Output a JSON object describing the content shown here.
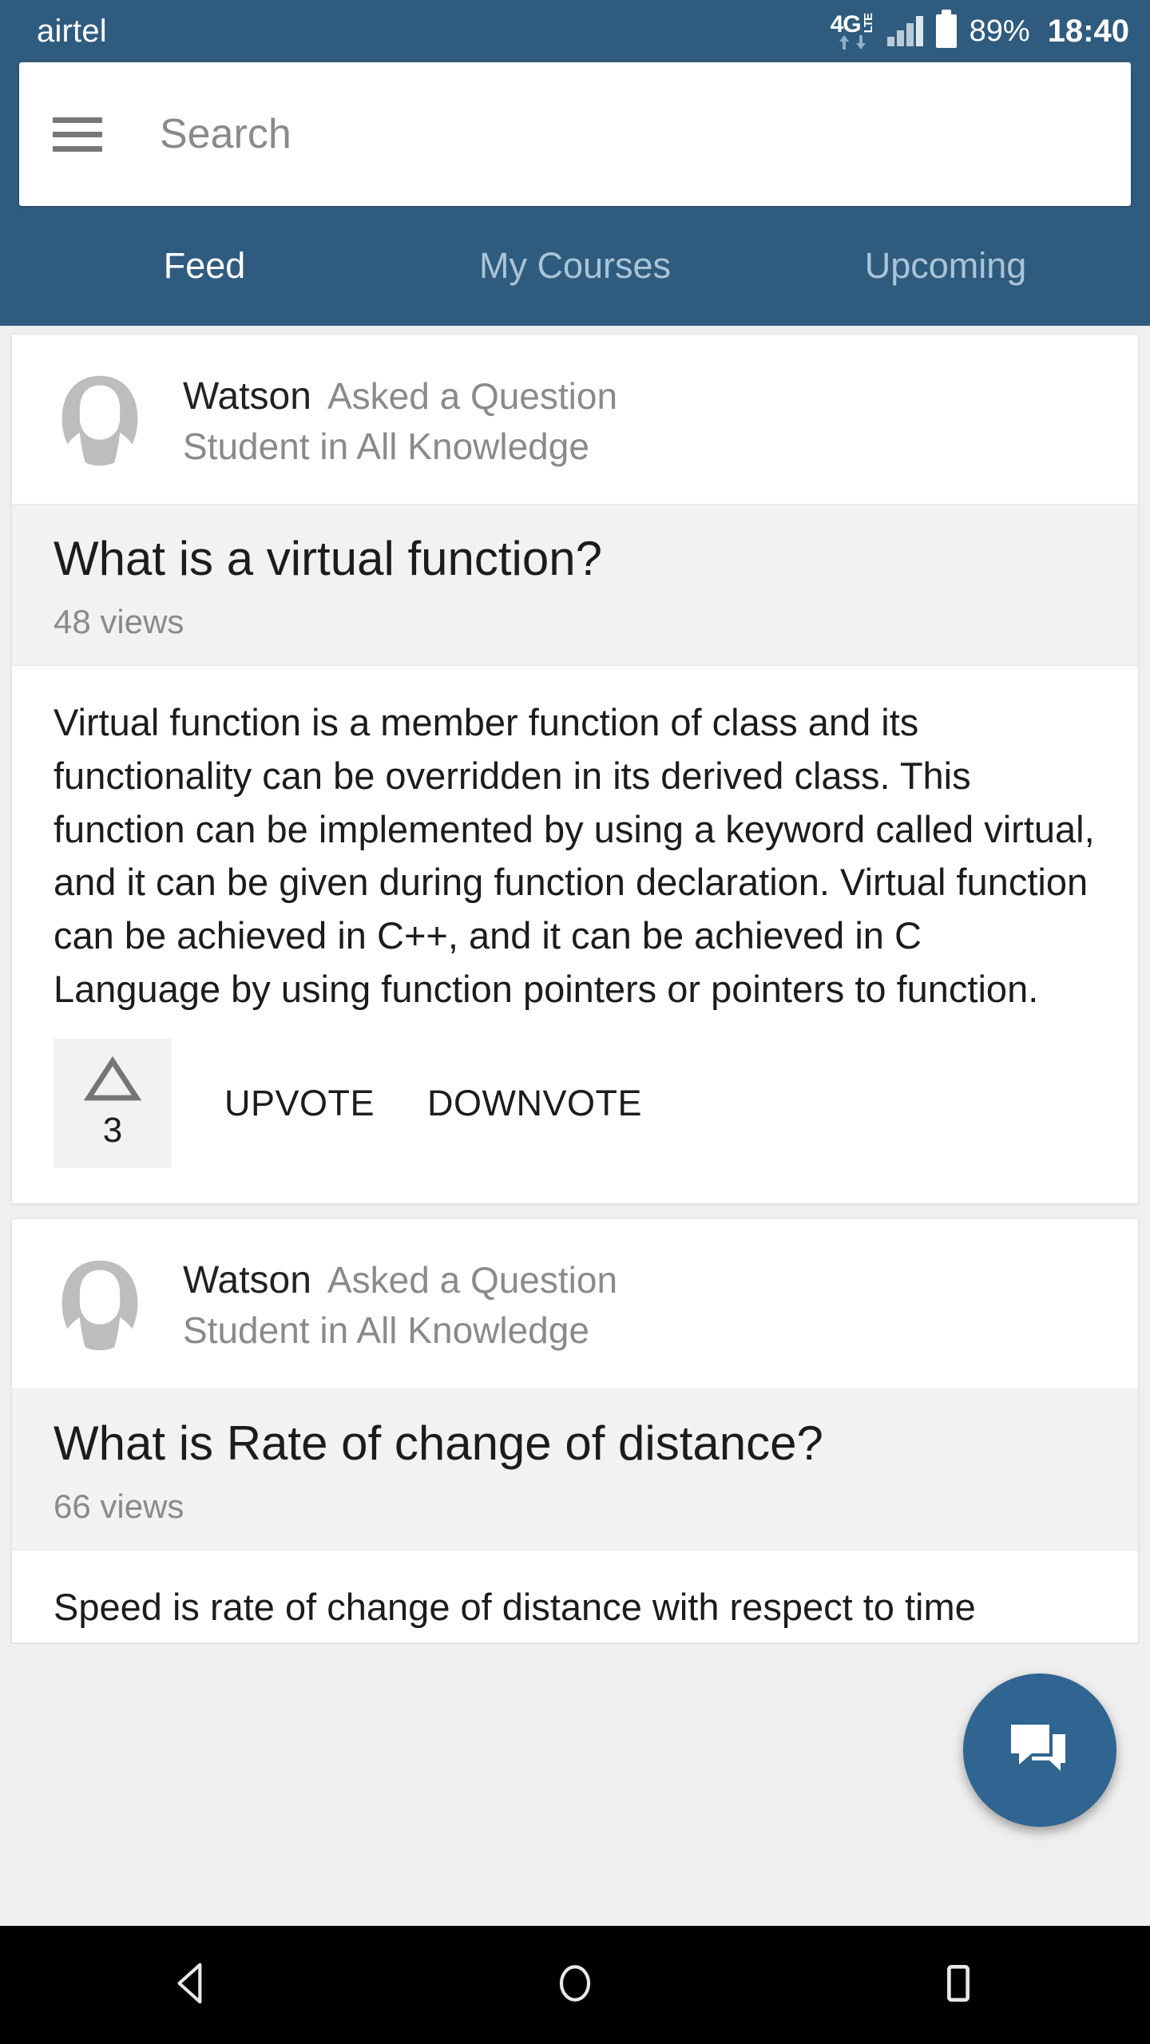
{
  "status_bar": {
    "carrier": "airtel",
    "network": "4G",
    "network_sub": "LTE",
    "battery_percent": "89%",
    "time": "18:40",
    "icons": [
      "data-up-arrow-icon",
      "data-down-arrow-icon",
      "signal-bars-icon",
      "battery-icon"
    ]
  },
  "header": {
    "menu_icon": "hamburger-menu-icon",
    "search_placeholder": "Search",
    "tabs": [
      {
        "label": "Feed",
        "active": true
      },
      {
        "label": "My Courses",
        "active": false
      },
      {
        "label": "Upcoming",
        "active": false
      }
    ]
  },
  "feed": {
    "posts": [
      {
        "author": "Watson",
        "action": "Asked a Question",
        "role": "Student in All Knowledge",
        "question": "What is a virtual function?",
        "views": "48 views",
        "body": "Virtual function is a member function of class and its functionality can be overridden in its derived class. This function can be implemented by using a keyword called virtual, and it can be given during function declaration. Virtual function can be achieved in C++, and it can be achieved in C Language by using function pointers or pointers to function.",
        "vote_count": "3",
        "upvote_label": "UPVOTE",
        "downvote_label": "DOWNVOTE"
      },
      {
        "author": "Watson",
        "action": "Asked a Question",
        "role": "Student in All Knowledge",
        "question": "What is Rate of change of distance?",
        "views": "66 views",
        "body": "Speed is rate of change of distance with respect to time"
      }
    ]
  },
  "fab": {
    "icon": "question-answer-icon"
  },
  "nav_bar": {
    "back": "back-triangle-icon",
    "home": "home-circle-icon",
    "recents": "recents-square-icon"
  },
  "colors": {
    "header_blue": "#2F5B7E",
    "fab_blue": "#2F6590",
    "band_gray": "#F2F2F2",
    "page_gray": "#EFEFEF",
    "muted_text": "#8A8A8A",
    "avatar_gray": "#BDBDBD"
  }
}
